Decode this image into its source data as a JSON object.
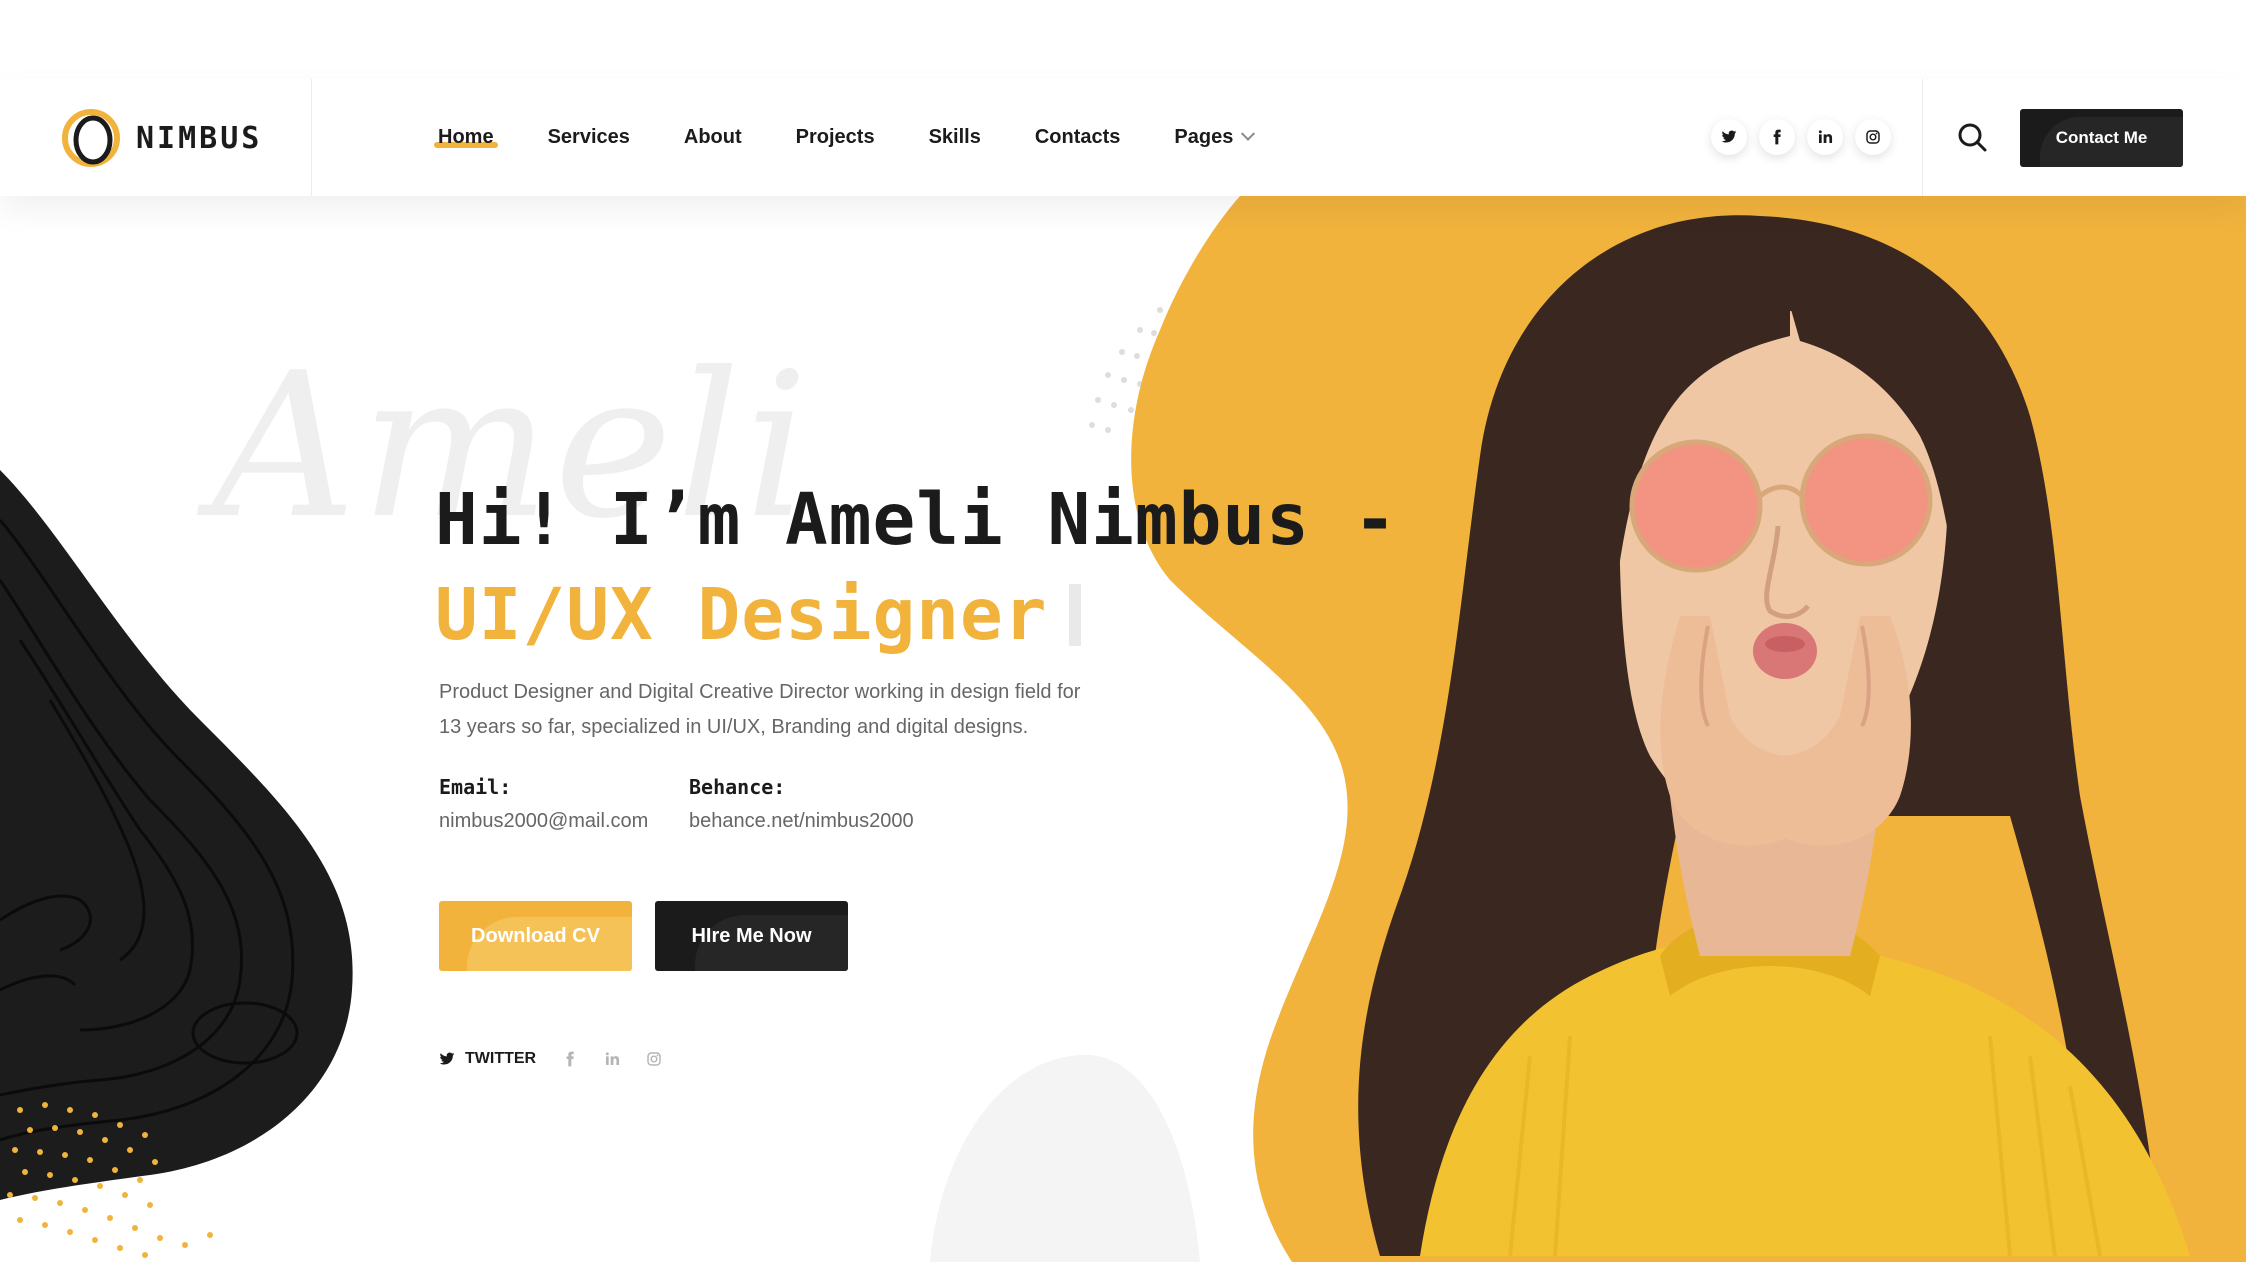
{
  "brand": {
    "name": "NIMBUS"
  },
  "nav": {
    "items": [
      {
        "label": "Home",
        "active": true
      },
      {
        "label": "Services"
      },
      {
        "label": "About"
      },
      {
        "label": "Projects"
      },
      {
        "label": "Skills"
      },
      {
        "label": "Contacts"
      },
      {
        "label": "Pages",
        "has_dropdown": true
      }
    ]
  },
  "header_social": [
    "twitter-icon",
    "facebook-icon",
    "linkedin-icon",
    "instagram-icon"
  ],
  "header": {
    "contact_label": "Contact Me"
  },
  "hero": {
    "watermark": "Ameli",
    "title_line1": "Hi! I’m Ameli Nimbus -",
    "title_line2": "UI/UX Designer",
    "description_line1": "Product Designer and Digital Creative Director working in design field for",
    "description_line2": "13 years so far, specialized in UI/UX, Branding and digital designs.",
    "email_label": "Email:",
    "email_value": "nimbus2000@mail.com",
    "behance_label": "Behance:",
    "behance_value": "behance.net/nimbus2000",
    "download_label": "Download CV",
    "hire_label": "HIre Me Now",
    "social_twitter_label": "TWITTER"
  },
  "colors": {
    "accent": "#f2b33d",
    "dark": "#1b1b1b",
    "muted": "#666666"
  }
}
